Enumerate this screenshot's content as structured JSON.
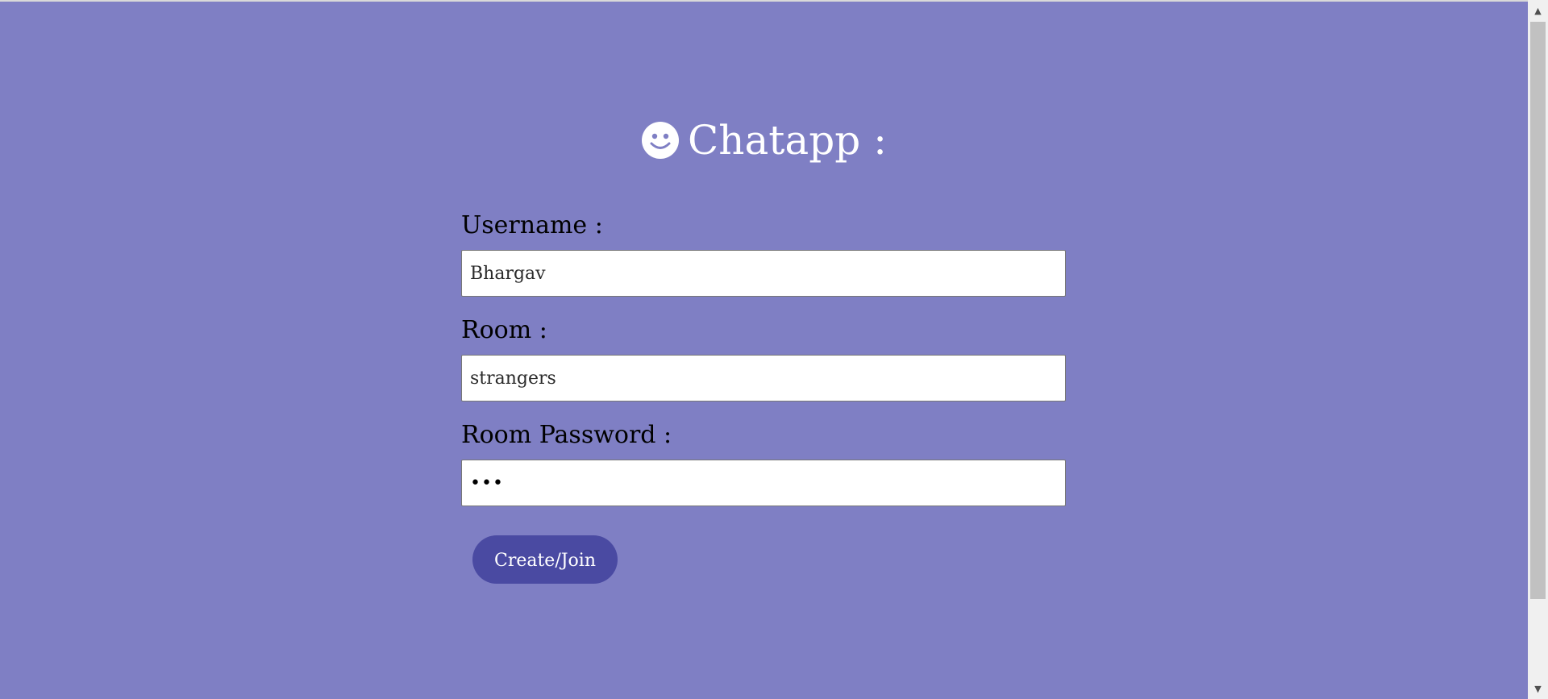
{
  "header": {
    "title": "Chatapp :",
    "icon": "smiley-face-icon"
  },
  "form": {
    "username": {
      "label": "Username :",
      "value": "Bhargav"
    },
    "room": {
      "label": "Room :",
      "value": "strangers"
    },
    "room_password": {
      "label": "Room Password :",
      "value": "•••"
    },
    "submit_label": "Create/Join"
  },
  "colors": {
    "background": "#7f7fc4",
    "button": "#4a4aa2",
    "text_light": "#ffffff"
  }
}
